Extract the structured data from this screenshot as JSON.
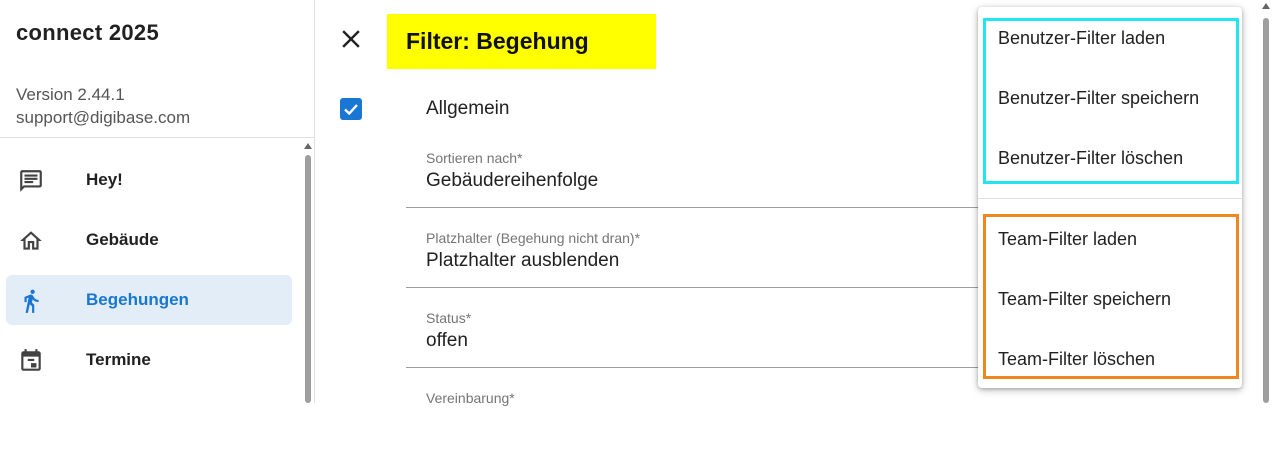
{
  "sidebar": {
    "app_title": "connect 2025",
    "version": "Version 2.44.1",
    "support_email": "support@digibase.com",
    "items": [
      {
        "label": "Hey!",
        "icon": "message-icon"
      },
      {
        "label": "Gebäude",
        "icon": "home-icon"
      },
      {
        "label": "Begehungen",
        "icon": "walking-person-icon",
        "active": true
      },
      {
        "label": "Termine",
        "icon": "calendar-icon"
      }
    ]
  },
  "dialog": {
    "title": "Filter: Begehung",
    "section": "Allgemein",
    "section_checked": true,
    "fields": [
      {
        "label": "Sortieren nach*",
        "value": "Gebäudereihenfolge"
      },
      {
        "label": "Platzhalter (Begehung nicht dran)*",
        "value": "Platzhalter ausblenden"
      },
      {
        "label": "Status*",
        "value": "offen"
      },
      {
        "label": "Vereinbarung*",
        "value": ""
      }
    ]
  },
  "menu": {
    "user_items": [
      "Benutzer-Filter laden",
      "Benutzer-Filter speichern",
      "Benutzer-Filter löschen"
    ],
    "team_items": [
      "Team-Filter laden",
      "Team-Filter speichern",
      "Team-Filter löschen"
    ]
  },
  "colors": {
    "accent": "#1976d2",
    "title_highlight": "#ffff00",
    "user_box": "#22e5ef",
    "team_box": "#f0861e",
    "active_nav_bg": "#e3edf8"
  }
}
